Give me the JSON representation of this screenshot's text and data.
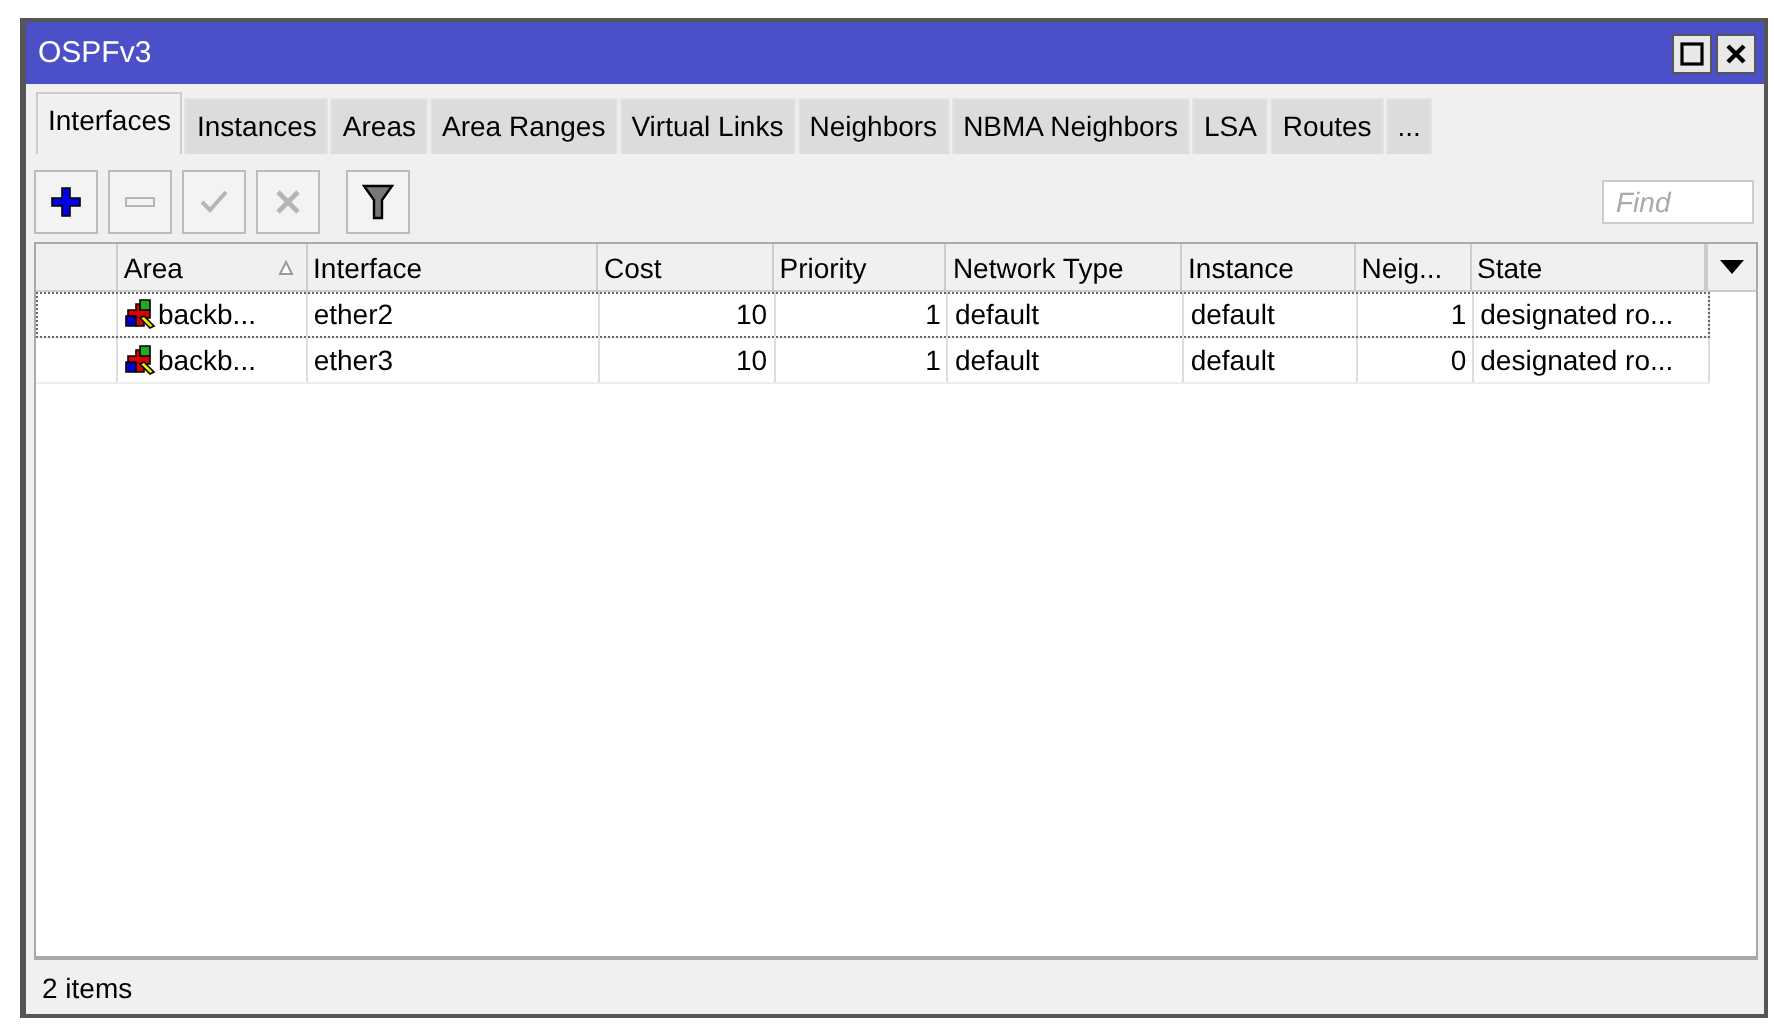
{
  "window": {
    "title": "OSPFv3"
  },
  "tabs": [
    {
      "label": "Interfaces",
      "selected": true
    },
    {
      "label": "Instances",
      "selected": false
    },
    {
      "label": "Areas",
      "selected": false
    },
    {
      "label": "Area Ranges",
      "selected": false
    },
    {
      "label": "Virtual Links",
      "selected": false
    },
    {
      "label": "Neighbors",
      "selected": false
    },
    {
      "label": "NBMA Neighbors",
      "selected": false
    },
    {
      "label": "LSA",
      "selected": false
    },
    {
      "label": "Routes",
      "selected": false
    },
    {
      "label": "...",
      "selected": false
    }
  ],
  "toolbar": [
    {
      "kind": "add",
      "disabled": false
    },
    {
      "kind": "remove",
      "disabled": true
    },
    {
      "kind": "enable",
      "disabled": true
    },
    {
      "kind": "disable",
      "disabled": true
    },
    {
      "kind": "filter",
      "disabled": false
    }
  ],
  "search": {
    "placeholder": "Find"
  },
  "table": {
    "columns": [
      {
        "label": "Area",
        "kind": "text",
        "sorted": true
      },
      {
        "label": "Interface",
        "kind": "text",
        "sorted": false
      },
      {
        "label": "Cost",
        "kind": "number",
        "sorted": false
      },
      {
        "label": "Priority",
        "kind": "number",
        "sorted": false
      },
      {
        "label": "Network Type",
        "kind": "text",
        "sorted": false
      },
      {
        "label": "Instance",
        "kind": "text",
        "sorted": false
      },
      {
        "label": "Neig...",
        "kind": "number",
        "sorted": false
      },
      {
        "label": "State",
        "kind": "text",
        "sorted": false
      }
    ],
    "rows": [
      {
        "selected": true,
        "cells": [
          "backb...",
          "ether2",
          "10",
          "1",
          "default",
          "default",
          "1",
          "designated ro..."
        ]
      },
      {
        "selected": false,
        "cells": [
          "backb...",
          "ether3",
          "10",
          "1",
          "default",
          "default",
          "0",
          "designated ro..."
        ]
      }
    ]
  },
  "status_bar": "2 items"
}
